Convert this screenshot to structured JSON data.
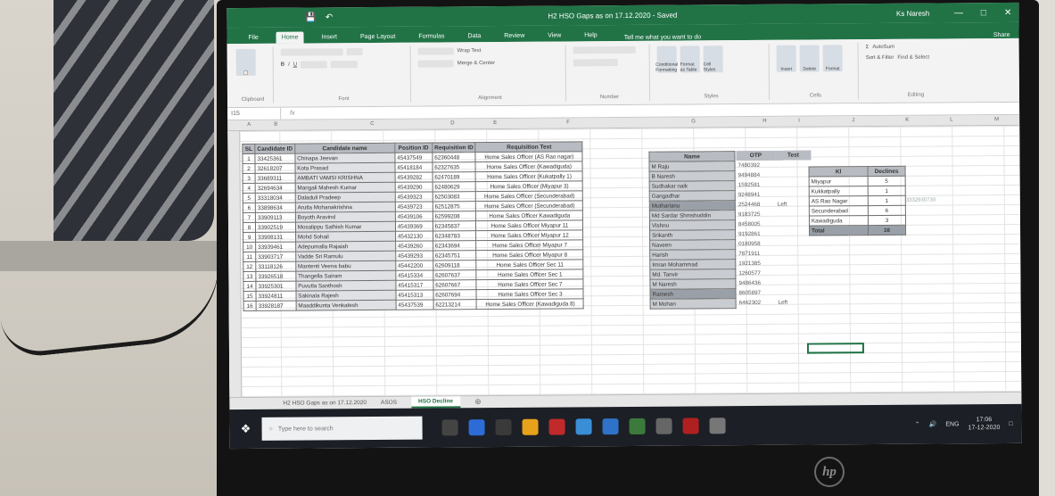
{
  "window": {
    "title": "H2 HSO Gaps as on 17.12.2020 - Saved",
    "user": "Ks Naresh",
    "tell_me": "Tell me what you want to do",
    "share": "Share"
  },
  "tabs": [
    "File",
    "Home",
    "Insert",
    "Page Layout",
    "Formulas",
    "Data",
    "Review",
    "View",
    "Help"
  ],
  "ribbon_groups": [
    "Clipboard",
    "Font",
    "Alignment",
    "Number",
    "Styles",
    "Cells",
    "Editing"
  ],
  "ribbon_labels": {
    "wrap_text": "Wrap Text",
    "merge_center": "Merge & Center",
    "conditional_formatting": "Conditional Formatting",
    "format_as_table": "Format as Table",
    "cell_styles": "Cell Styles",
    "insert": "Insert",
    "delete": "Delete",
    "format": "Format",
    "autosum": "AutoSum",
    "sort_filter": "Sort & Filter",
    "find_select": "Find & Select"
  },
  "formula_bar": {
    "name_box": "I15",
    "fx": "fx"
  },
  "column_headers": [
    "A",
    "B",
    "C",
    "D",
    "E",
    "F",
    "G",
    "H",
    "I",
    "J",
    "K",
    "L",
    "M"
  ],
  "main_table": {
    "headers": [
      "SL",
      "Candidate ID",
      "Candidate name",
      "Position ID",
      "Requisition ID",
      "Requisition Text"
    ],
    "rows": [
      [
        "1",
        "33425361",
        "Chinapa Jeevan",
        "45437549",
        "62360448",
        "Home Sales Officer (AS Rao nagar)"
      ],
      [
        "2",
        "32618207",
        "Kota Prasad",
        "45418184",
        "62327635",
        "Home Sales Officer (Kawadiguda)"
      ],
      [
        "3",
        "33689311",
        "AMBATI VAMSI KRISHNA",
        "45439282",
        "62470189",
        "Home Sales Officer (Kukatpally 1)"
      ],
      [
        "4",
        "32694634",
        "Mangali Mahesh Kumar",
        "45439290",
        "62480629",
        "Home Sales Officer (Miyapur 3)"
      ],
      [
        "5",
        "33318034",
        "Daladuli Pradeep",
        "45439323",
        "62503083",
        "Home Sales Officer (Secunderabad)"
      ],
      [
        "6",
        "33898634",
        "Arutla Mohanakrishna",
        "45439723",
        "62512875",
        "Home Sales Officer (Secunderabad)"
      ],
      [
        "7",
        "33909113",
        "Boyoth Aravind",
        "45439106",
        "62599208",
        "Home Sales Officer Kawadiguda"
      ],
      [
        "8",
        "33902519",
        "Mosalippu Sathish Kumar",
        "45439369",
        "62345837",
        "Home Sales Officer Miyapur 11"
      ],
      [
        "9",
        "33908131",
        "Mohd Sohail",
        "45432130",
        "62348783",
        "Home Sales Officer Miyapur 12"
      ],
      [
        "10",
        "33939461",
        "Adepumalla Rajaiah",
        "45439260",
        "62343694",
        "Home Sales Officer Miyapur 7"
      ],
      [
        "11",
        "33903717",
        "Vadde Sri Ramulu",
        "45439293",
        "62345751",
        "Home Sales Officer Miyapur 8"
      ],
      [
        "12",
        "33118126",
        "Mantenti Veena babu",
        "45442200",
        "62609118",
        "Home Sales Officer Sec 11"
      ],
      [
        "13",
        "33926518",
        "Thangella Sairam",
        "45415334",
        "62607637",
        "Home Sales Officer Sec 1"
      ],
      [
        "14",
        "33925301",
        "Puvutla Santhosh",
        "45415317",
        "62607667",
        "Home Sales Officer Sec 7"
      ],
      [
        "15",
        "33924811",
        "Sakinala Rajesh",
        "45415313",
        "62607694",
        "Home Sales Officer Sec 3"
      ],
      [
        "16",
        "33928187",
        "Maaddikunta Venkatesh",
        "45437539",
        "62213214",
        "Home Sales Officer (Kawadiguda 8)"
      ]
    ]
  },
  "name_table": {
    "header": "Name",
    "names": [
      "M Raju",
      "B Naresh",
      "Sudhakar naik",
      "Gangadhar",
      "Mutharianu",
      "Md Sardar Shmshuddin",
      "Vishnu",
      "Srikanth",
      "Naveen",
      "Harish",
      "Imran Mohammad",
      "Md. Tanvir",
      "M Naresh",
      "Ramesh",
      "M Mohan"
    ]
  },
  "otp_table": {
    "headers": [
      "OTP",
      "Test"
    ],
    "rows": [
      [
        "7480392",
        ""
      ],
      [
        "9494884",
        ""
      ],
      [
        "1592581",
        ""
      ],
      [
        "9248941",
        ""
      ],
      [
        "2524468",
        "Left"
      ],
      [
        "9183725",
        ""
      ],
      [
        "8458005",
        ""
      ],
      [
        "9192861",
        ""
      ],
      [
        "0180958",
        ""
      ],
      [
        "7871911",
        ""
      ],
      [
        "1921385",
        ""
      ],
      [
        "1260577",
        ""
      ],
      [
        "9486436",
        ""
      ],
      [
        "8605897",
        ""
      ],
      [
        "6462302",
        "Left"
      ]
    ]
  },
  "summary_table": {
    "headers": [
      "Kl",
      "Declines"
    ],
    "rows": [
      [
        "Miyapur",
        "5"
      ],
      [
        "Kukkatpally",
        "1"
      ],
      [
        "AS Rao Nagar",
        "1"
      ],
      [
        "Secunderabad",
        "6"
      ],
      [
        "Kawadiguda",
        "3"
      ]
    ],
    "total_label": "Total",
    "total_value": "16"
  },
  "side_note": "3332930730",
  "sheet_tabs": [
    "H2 HSO Gaps as on 17.12.2020",
    "ASOS",
    "HSO Decline"
  ],
  "taskbar": {
    "search_placeholder": "Type here to search",
    "language": "ENG",
    "time": "17:06",
    "date": "17-12-2020"
  },
  "brand": "hp",
  "colors": {
    "excel_green": "#217346",
    "header_fill": "#b8bcc2",
    "name_fill": "#c9ccd1"
  }
}
